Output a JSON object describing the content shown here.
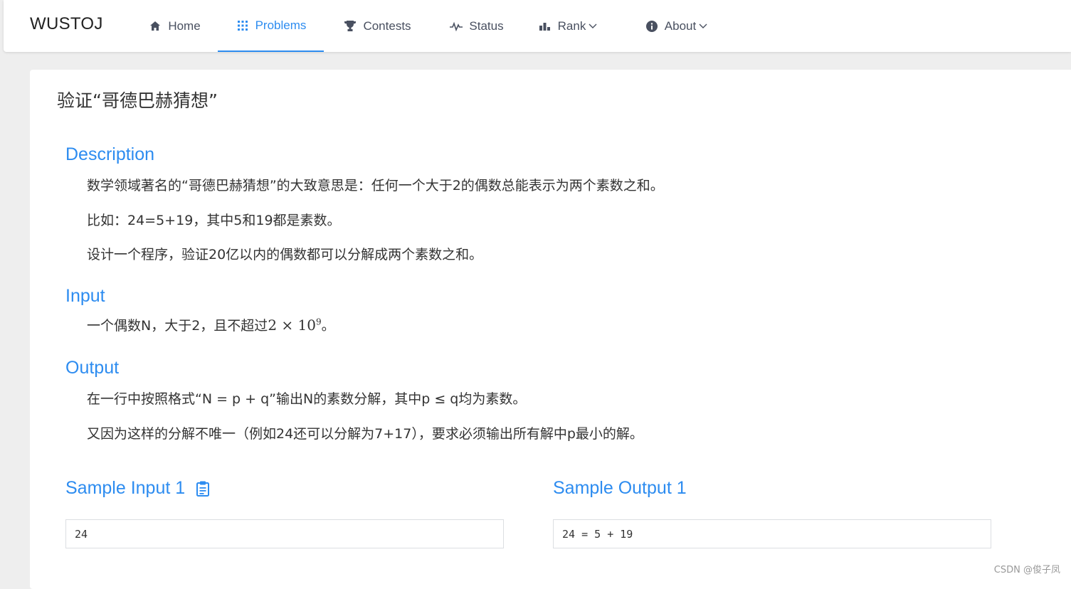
{
  "nav": {
    "logo": "WUSTOJ",
    "items": [
      {
        "label": "Home",
        "icon": "home-icon"
      },
      {
        "label": "Problems",
        "icon": "grid-icon"
      },
      {
        "label": "Contests",
        "icon": "trophy-icon"
      },
      {
        "label": "Status",
        "icon": "pulse-icon"
      },
      {
        "label": "Rank",
        "icon": "bar-chart-icon"
      },
      {
        "label": "About",
        "icon": "info-icon"
      }
    ],
    "active": "Problems",
    "accent": "#2d8cf0"
  },
  "problem": {
    "title": "验证“哥德巴赫猜想”",
    "description_heading": "Description",
    "description": [
      "数学领域著名的“哥德巴赫猜想”的大致意思是：任何一个大于2的偶数总能表示为两个素数之和。",
      "比如：24=5+19，其中5和19都是素数。",
      "设计一个程序，验证20亿以内的偶数都可以分解成两个素数之和。"
    ],
    "input_heading": "Input",
    "input_text": "一个偶数N，大于2，且不超过",
    "input_math_base": "2 × 10",
    "input_math_exp": "9",
    "input_tail": "。",
    "output_heading": "Output",
    "output": [
      "在一行中按照格式“N = p + q”输出N的素数分解，其中p ≤ q均为素数。",
      "又因为这样的分解不唯一（例如24还可以分解为7+17），要求必须输出所有解中p最小的解。"
    ],
    "sample_input_heading": "Sample Input 1",
    "sample_output_heading": "Sample Output 1",
    "sample_input": "24",
    "sample_output": "24 = 5 + 19"
  },
  "watermark": "CSDN @俊子凤"
}
